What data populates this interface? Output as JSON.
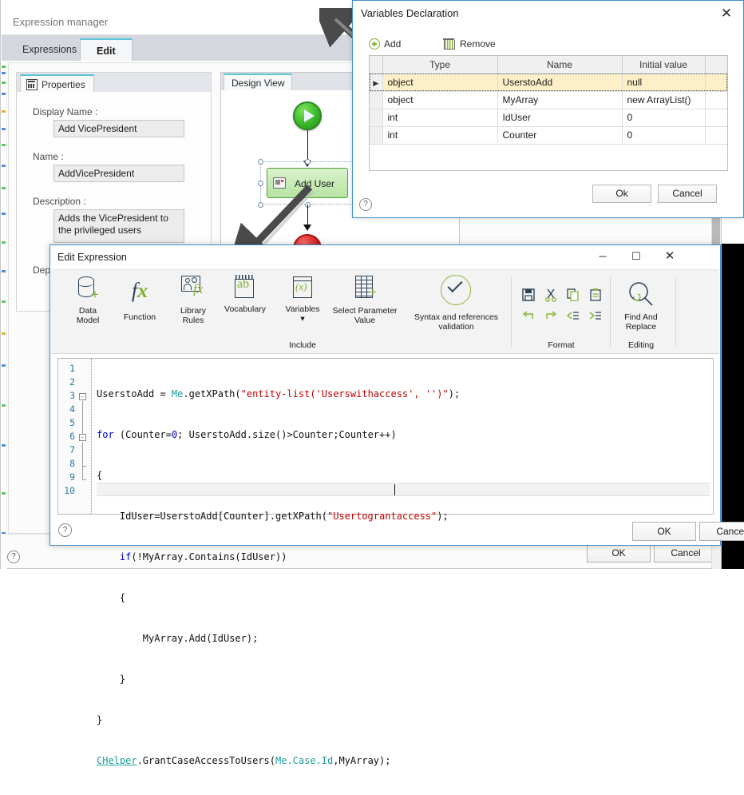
{
  "app": {
    "title": "Expression manager",
    "tabs": [
      {
        "label": "Expressions",
        "active": false
      },
      {
        "label": "Edit",
        "active": true
      }
    ],
    "footer": {
      "ok": "OK",
      "cancel": "Cancel",
      "help": "?"
    }
  },
  "properties": {
    "tab_label": "Properties",
    "fields": [
      {
        "label": "Display Name :",
        "value": "Add VicePresident"
      },
      {
        "label": "Name :",
        "value": "AddVicePresident"
      },
      {
        "label": "Description :",
        "value": "Adds the VicePresident to the privileged users"
      }
    ],
    "dependencies_label": "Depen"
  },
  "design_view": {
    "tab_label": "Design View",
    "nodes": [
      {
        "name": "start",
        "label": ""
      },
      {
        "name": "activity",
        "label": "Add User"
      },
      {
        "name": "stop",
        "label": ""
      }
    ]
  },
  "variables_dialog": {
    "title": "Variables Declaration",
    "close": "✕",
    "add_label": "Add",
    "remove_label": "Remove",
    "columns": [
      "Type",
      "Name",
      "Initial value"
    ],
    "rows": [
      {
        "type": "object",
        "name": "UserstoAdd",
        "initial": "null",
        "selected": true
      },
      {
        "type": "object",
        "name": "MyArray",
        "initial": "new ArrayList()",
        "selected": false
      },
      {
        "type": "int",
        "name": "IdUser",
        "initial": "0",
        "selected": false
      },
      {
        "type": "int",
        "name": "Counter",
        "initial": "0",
        "selected": false
      }
    ],
    "ok": "Ok",
    "cancel": "Cancel",
    "help": "?",
    "selected_row_color": "#fdf0c8"
  },
  "edit_dialog": {
    "title": "Edit Expression",
    "window_buttons": {
      "minimize": "─",
      "maximize": "☐",
      "close": "✕"
    },
    "ribbon": {
      "items": [
        {
          "icon": "data-model-icon",
          "line1": "Data",
          "line2": "Model"
        },
        {
          "icon": "function-icon",
          "line1": "Function",
          "line2": ""
        },
        {
          "icon": "library-rules-icon",
          "line1": "Library",
          "line2": "Rules"
        },
        {
          "icon": "vocabulary-icon",
          "line1": "Vocabulary",
          "line2": ""
        },
        {
          "icon": "variables-icon",
          "line1": "Variables",
          "line2": "▾"
        },
        {
          "icon": "select-parameter-value-icon",
          "line1": "Select Parameter",
          "line2": "Value"
        },
        {
          "icon": "syntax-validation-icon",
          "line1": "Syntax and references",
          "line2": "validation"
        }
      ],
      "groups": [
        {
          "name": "include-group",
          "label": "Include"
        },
        {
          "name": "format-group",
          "label": "Format"
        },
        {
          "name": "editing-group",
          "label": "Editing"
        }
      ],
      "format_icons": [
        "save-icon",
        "cut-icon",
        "copy-icon",
        "paste-icon",
        "undo-icon",
        "redo-icon",
        "outdent-icon",
        "indent-icon"
      ],
      "find_replace": {
        "icon": "find-and-replace-icon",
        "line1": "Find And",
        "line2": "Replace"
      }
    },
    "editor": {
      "lines": [
        {
          "no": "1",
          "fold": "",
          "html": "UserstoAdd = <span class=\"typ\">Me</span>.getXPath(<span class=\"str\">\"entity-list('Userswithaccess', '')\"</span>);"
        },
        {
          "no": "2",
          "fold": "",
          "html": "<span class=\"kw\">for</span> (Counter=<span class=\"num\">0</span>; UserstoAdd.size()&gt;Counter;Counter++)"
        },
        {
          "no": "3",
          "fold": "-",
          "html": "{"
        },
        {
          "no": "4",
          "fold": "",
          "html": "    IdUser=UserstoAdd[Counter].getXPath(<span class=\"str\">\"Usertograntaccess\"</span>);"
        },
        {
          "no": "5",
          "fold": "",
          "html": "    <span class=\"kw\">if</span>(!MyArray.Contains(IdUser))"
        },
        {
          "no": "6",
          "fold": "-",
          "html": "    {"
        },
        {
          "no": "7",
          "fold": "",
          "html": "        MyArray.Add(IdUser);"
        },
        {
          "no": "8",
          "fold": "",
          "html": "    }"
        },
        {
          "no": "9",
          "fold": "",
          "html": "}"
        },
        {
          "no": "10",
          "fold": "",
          "html": "<span class=\"lnk\">CHelper</span>.GrantCaseAccessToUsers(<span class=\"typ\">Me.Case.Id</span>,MyArray);"
        }
      ],
      "plain_text": "UserstoAdd = Me.getXPath(\"entity-list('Userswithaccess', '')\");\nfor (Counter=0; UserstoAdd.size()>Counter;Counter++)\n{\n    IdUser=UserstoAdd[Counter].getXPath(\"Usertograntaccess\");\n    if(!MyArray.Contains(IdUser))\n    {\n        MyArray.Add(IdUser);\n    }\n}\nCHelper.GrantCaseAccessToUsers(Me.Case.Id,MyArray);",
      "current_line": 10,
      "total_lines": 10
    },
    "ok": "OK",
    "cancel": "Cancel",
    "help": "?"
  },
  "colors": {
    "accent_blue": "#3d8fd1",
    "tab_accent": "#5bc4d8",
    "selection_yellow": "#fdf0c8",
    "node_green": "#b7e4a2",
    "start_green": "#3ab82b",
    "stop_red": "#d41f1f",
    "keyword_blue": "#0000d0",
    "string_red": "#c00000",
    "type_teal": "#1a9c9c",
    "ribbon_green": "#7fb135",
    "ribbon_navy": "#2c4257"
  }
}
